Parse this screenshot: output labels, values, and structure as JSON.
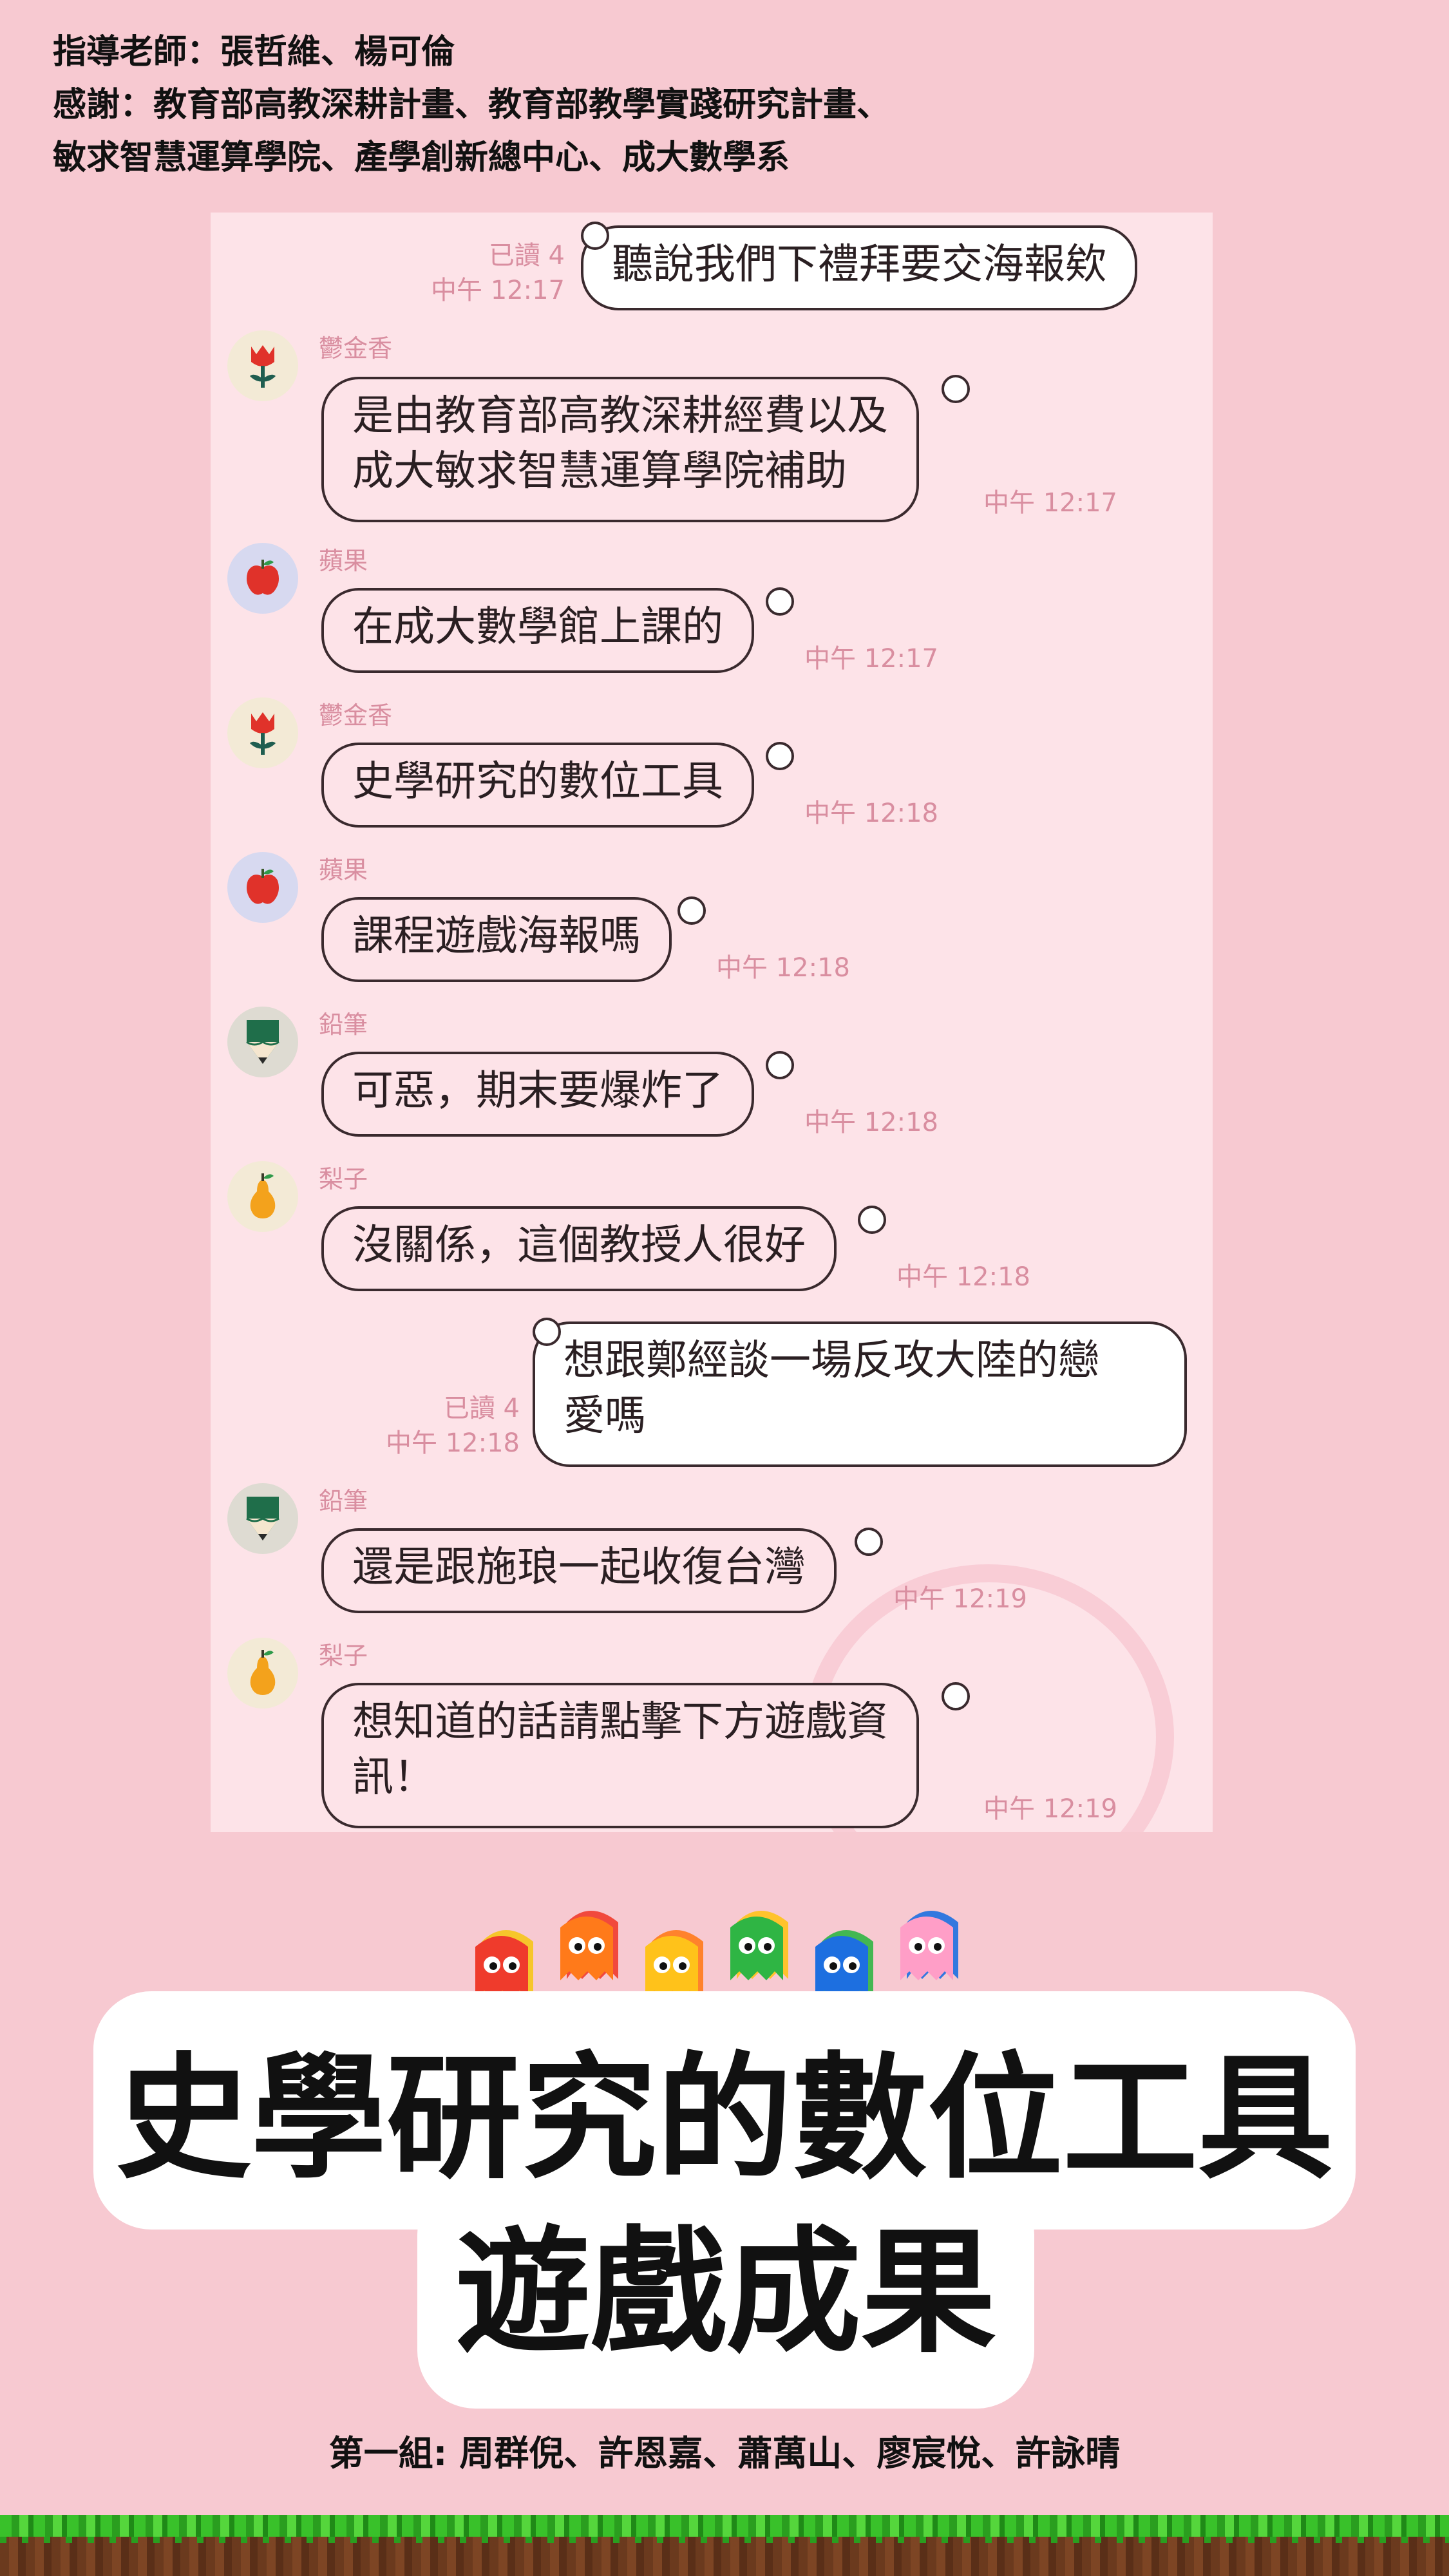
{
  "credits": {
    "line1": "指導老師：張哲維、楊可倫",
    "line2": "感謝：教育部高教深耕計畫、教育部教學實踐研究計畫、",
    "line3": "敏求智慧運算學院、產學創新總中心、成大數學系"
  },
  "chat": {
    "messages": [
      {
        "type": "out",
        "text": "聽說我們下禮拜要交海報欸",
        "read": "已讀 4",
        "time": "中午 12:17"
      },
      {
        "type": "in",
        "sender": "鬱金香",
        "avatar": "tulip-icon",
        "lines": [
          "是由教育部高教深耕經費以及",
          "成大敏求智慧運算學院補助"
        ],
        "time": "中午 12:17"
      },
      {
        "type": "in",
        "sender": "蘋果",
        "avatar": "apple-icon",
        "lines": [
          "在成大數學館上課的"
        ],
        "time": "中午 12:17"
      },
      {
        "type": "in",
        "sender": "鬱金香",
        "avatar": "tulip-icon",
        "lines": [
          "史學研究的數位工具"
        ],
        "time": "中午 12:18"
      },
      {
        "type": "in",
        "sender": "蘋果",
        "avatar": "apple-icon",
        "lines": [
          "課程遊戲海報嗎"
        ],
        "time": "中午 12:18"
      },
      {
        "type": "in",
        "sender": "鉛筆",
        "avatar": "pencil-icon",
        "lines": [
          "可惡，期末要爆炸了"
        ],
        "time": "中午 12:18"
      },
      {
        "type": "in",
        "sender": "梨子",
        "avatar": "pear-icon",
        "lines": [
          "沒關係，這個教授人很好"
        ],
        "time": "中午 12:18"
      },
      {
        "type": "out",
        "lines": [
          "想跟鄭經談一場反攻大陸的戀",
          "愛嗎"
        ],
        "read": "已讀 4",
        "time": "中午 12:18"
      },
      {
        "type": "in",
        "sender": "鉛筆",
        "avatar": "pencil-icon",
        "lines": [
          "還是跟施琅一起收復台灣"
        ],
        "time": "中午 12:19"
      },
      {
        "type": "in",
        "sender": "梨子",
        "avatar": "pear-icon",
        "lines": [
          "想知道的話請點擊下方遊戲資",
          "訊！"
        ],
        "time": "中午 12:19"
      }
    ]
  },
  "ghosts": {
    "colors": [
      "#ef3b2c",
      "#ff7a1a",
      "#ffc21a",
      "#2fb544",
      "#1d6fe0",
      "#ff9ec7"
    ],
    "icon": "ghost-icon"
  },
  "title": {
    "line1": "史學研究的數位工具",
    "line2": "遊戲成果"
  },
  "members": "第一組:  周群倪、許恩嘉、蕭萬山、廖宸悅、許詠晴"
}
